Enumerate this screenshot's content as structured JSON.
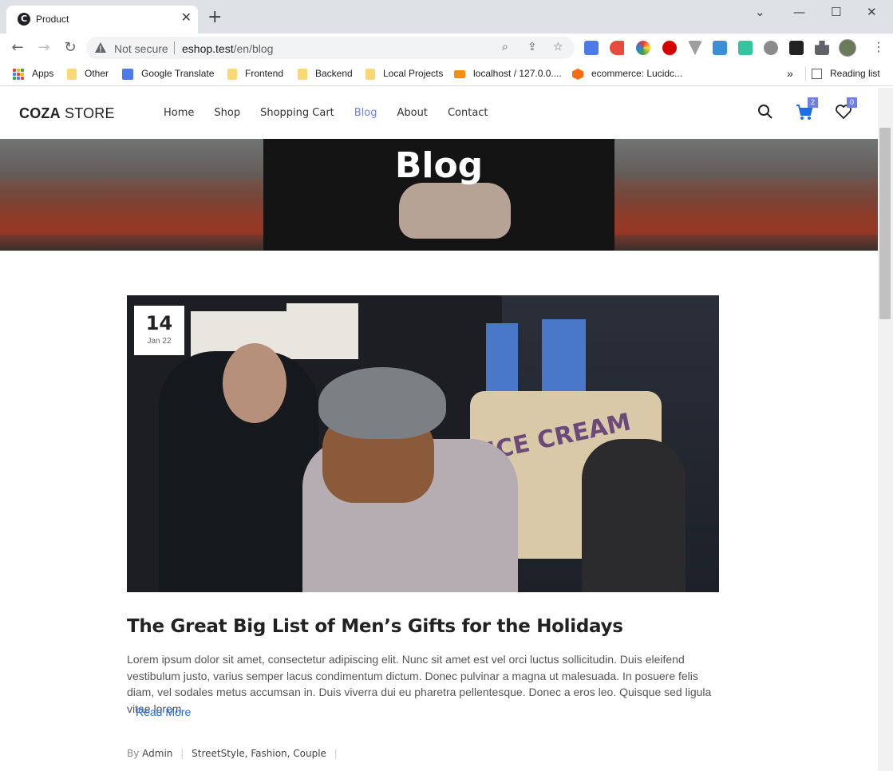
{
  "browser": {
    "tab_title": "Product",
    "tab_favicon_letter": "C",
    "not_secure_label": "Not secure",
    "url_host": "eshop.test",
    "url_path": "/en/blog",
    "bookmarks": [
      {
        "label": "Apps",
        "icon": "apps-grid-icon"
      },
      {
        "label": "Other",
        "icon": "folder-icon"
      },
      {
        "label": "Google Translate",
        "icon": "google-translate-icon"
      },
      {
        "label": "Frontend",
        "icon": "folder-icon"
      },
      {
        "label": "Backend",
        "icon": "folder-icon"
      },
      {
        "label": "Local Projects",
        "icon": "folder-icon"
      },
      {
        "label": "localhost / 127.0.0....",
        "icon": "phpmyadmin-icon"
      },
      {
        "label": "ecommerce: Lucidc...",
        "icon": "lucidchart-icon"
      }
    ],
    "bookmarks_overflow": "»",
    "reading_list_label": "Reading list"
  },
  "site": {
    "logo_bold": "COZA",
    "logo_light": " STORE",
    "nav": [
      {
        "label": "Home",
        "active": false
      },
      {
        "label": "Shop",
        "active": false
      },
      {
        "label": "Shopping Cart",
        "active": false
      },
      {
        "label": "Blog",
        "active": true
      },
      {
        "label": "About",
        "active": false
      },
      {
        "label": "Contact",
        "active": false
      }
    ],
    "cart_count": "2",
    "wishlist_count": "0",
    "accent_color": "#717fe0"
  },
  "hero": {
    "title": "Blog"
  },
  "post": {
    "day": "14",
    "month_year": "Jan 22",
    "title": "The Great Big List of Men’s Gifts for the Holidays",
    "excerpt": "Lorem ipsum dolor sit amet, consectetur adipiscing elit. Nunc sit amet est vel orci luctus sollicitudin. Duis eleifend vestibulum justo, varius semper lacus condimentum dictum. Donec pulvinar a magna ut malesuada. In posuere felis diam, vel sodales metus accumsan in. Duis viverra dui eu pharetra pellentesque. Donec a eros leo. Quisque sed ligula vitae lorem",
    "read_more": "Read More",
    "by_label": "By",
    "author": "Admin",
    "tags": "StreetStyle, Fashion, Couple",
    "image_text": "ICE CREAM"
  }
}
